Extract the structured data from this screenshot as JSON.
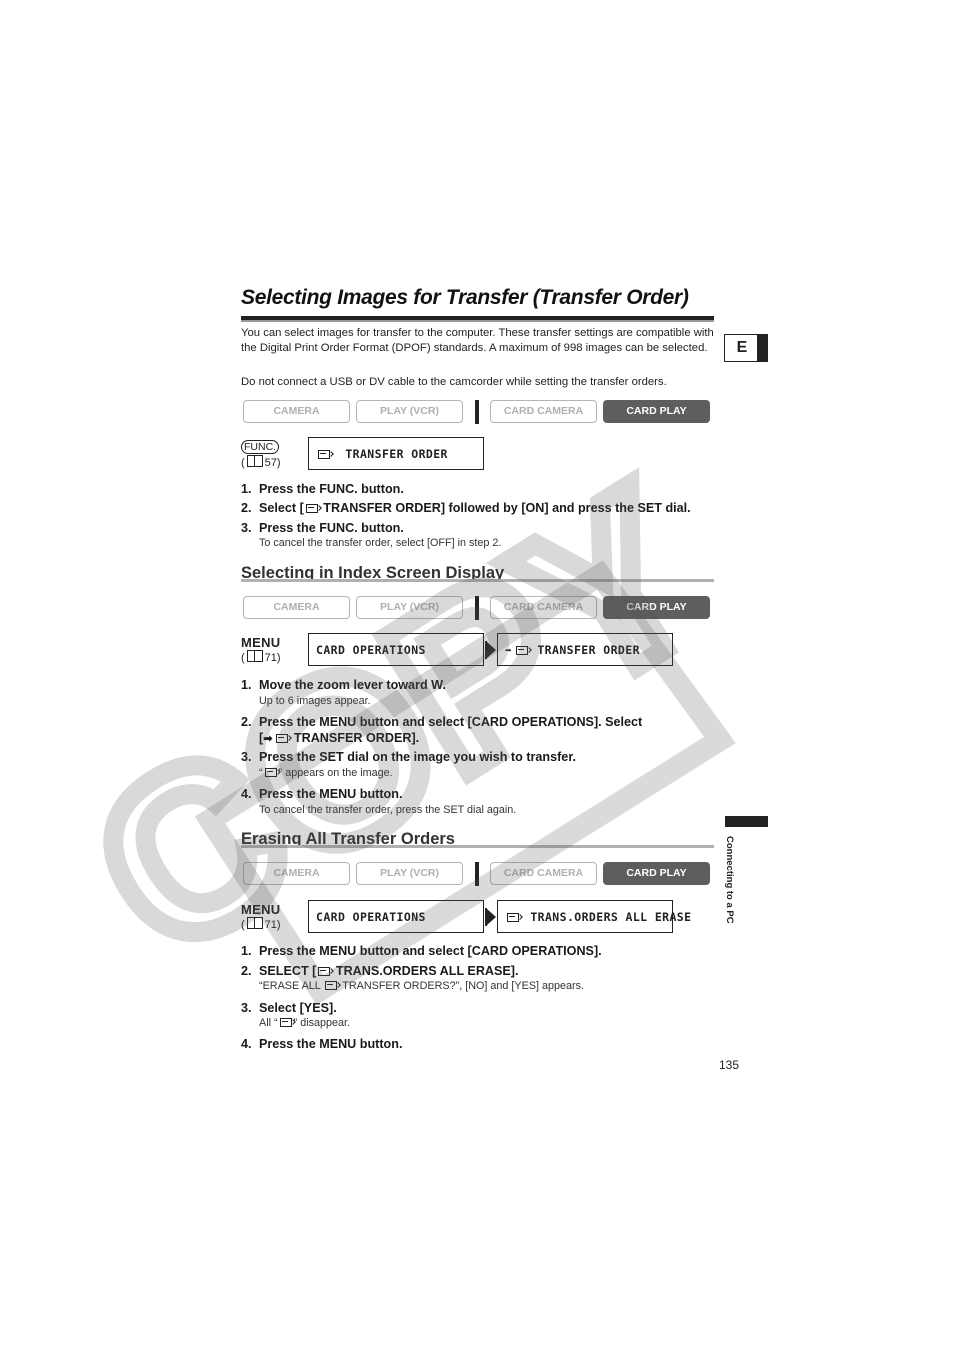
{
  "title": "Selecting Images for Transfer (Transfer Order)",
  "intro": {
    "paragraph1": "You can select images for transfer to the computer. These transfer settings are compatible with the Digital Print Order Format (DPOF) standards. A maximum of 998 images can be selected.",
    "paragraph2": "Do not connect a USB or DV cable to the camcorder while setting the transfer orders."
  },
  "modes": {
    "camera": "CAMERA",
    "play_vcr": "PLAY (VCR)",
    "card_camera": "CARD CAMERA",
    "card_play": "CARD PLAY",
    "active": "CARD PLAY"
  },
  "section1": {
    "button_label": "FUNC.",
    "ref_page": "57",
    "lcd": [
      {
        "icon": "transfer-order-icon",
        "text": "TRANSFER ORDER"
      }
    ],
    "steps": [
      {
        "num": "1.",
        "text": "Press the FUNC. button."
      },
      {
        "num": "2.",
        "pre": "Select [",
        "icon": "transfer-order-icon",
        "post": " TRANSFER ORDER] followed by [ON] and press the SET dial."
      },
      {
        "num": "3.",
        "text": "Press the FUNC. button.",
        "note": "To cancel the transfer order, select [OFF] in step 2."
      }
    ]
  },
  "section2": {
    "heading": "Selecting in Index Screen Display",
    "button_label": "MENU",
    "ref_page": "71",
    "lcd": [
      {
        "text": "CARD OPERATIONS"
      },
      {
        "icon": "arrow-transfer-icon",
        "text": "TRANSFER ORDER"
      }
    ],
    "steps": [
      {
        "num": "1.",
        "text": "Move the zoom lever toward W.",
        "note": "Up to 6 images appear."
      },
      {
        "num": "2.",
        "line1": "Press the MENU button and select [CARD OPERATIONS]. Select",
        "line2_pre": "[",
        "line2_post": " TRANSFER ORDER]."
      },
      {
        "num": "3.",
        "text": "Press the SET dial on the image you wish to transfer.",
        "note_pre": "“",
        "note_post": "” appears on the image."
      },
      {
        "num": "4.",
        "text": "Press the MENU button.",
        "note": "To cancel the transfer order, press the SET dial again."
      }
    ]
  },
  "section3": {
    "heading": "Erasing All Transfer Orders",
    "button_label": "MENU",
    "ref_page": "71",
    "lcd": [
      {
        "text": "CARD OPERATIONS"
      },
      {
        "icon": "transfer-icon",
        "text": "TRANS.ORDERS ALL ERASE"
      }
    ],
    "steps": [
      {
        "num": "1.",
        "text": "Press the MENU button and select [CARD OPERATIONS]."
      },
      {
        "num": "2.",
        "pre": "SELECT [",
        "post": " TRANS.ORDERS ALL ERASE].",
        "note_pre": "“ERASE ALL ",
        "note_post": " TRANSFER ORDERS?”, [NO] and [YES] appears."
      },
      {
        "num": "3.",
        "text": "Select [YES].",
        "note_pre": "All “",
        "note_post": "” disappear."
      },
      {
        "num": "4.",
        "text": "Press the MENU button."
      }
    ]
  },
  "side": {
    "language": "E",
    "chapter": "Connecting to a PC"
  },
  "page_number": "135",
  "watermark": "COPY"
}
